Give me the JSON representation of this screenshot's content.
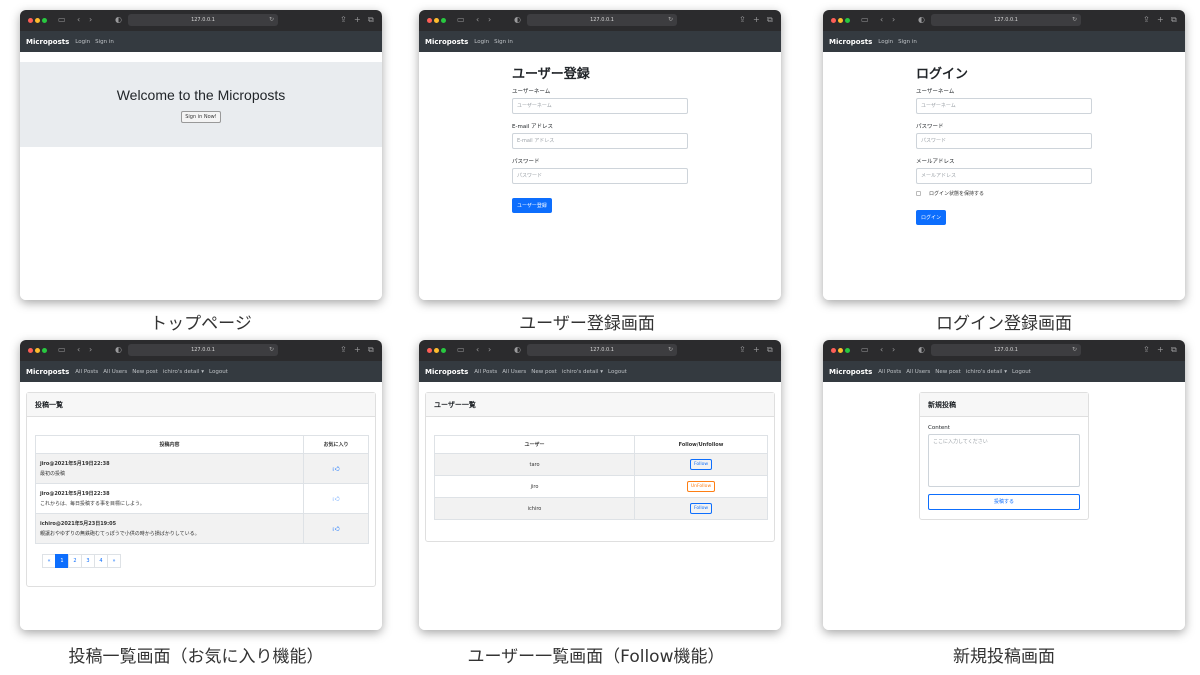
{
  "browser": {
    "address": "127.0.0.1"
  },
  "app": {
    "brand": "Microposts"
  },
  "nav_guest": {
    "login": "Login",
    "signin": "Sign in"
  },
  "nav_user": {
    "all_posts": "All Posts",
    "all_users": "All Users",
    "new_post": "New post",
    "detail": "ichiro's detail",
    "logout": "Logout"
  },
  "top": {
    "heading": "Welcome to the Microposts",
    "button": "Sign in Now!",
    "caption": "トップページ"
  },
  "register": {
    "heading": "ユーザー登録",
    "username_label": "ユーザーネーム",
    "username_placeholder": "ユーザーネーム",
    "email_label": "E-mail アドレス",
    "email_placeholder": "E-mail アドレス",
    "password_label": "パスワード",
    "password_placeholder": "パスワード",
    "submit": "ユーザー登録",
    "caption": "ユーザー登録画面"
  },
  "login": {
    "heading": "ログイン",
    "username_label": "ユーザーネーム",
    "username_placeholder": "ユーザーネーム",
    "password_label": "パスワード",
    "password_placeholder": "パスワード",
    "email_label": "メールアドレス",
    "email_placeholder": "メールアドレス",
    "remember": "ログイン状態を保持する",
    "submit": "ログイン",
    "caption": "ログイン登録画面"
  },
  "posts": {
    "title": "投稿一覧",
    "col_content": "投稿内容",
    "col_fav": "お気に入り",
    "rows": [
      {
        "meta": "jiro@2021年5月19日22:38",
        "text": "最初の投稿",
        "fav": "liked"
      },
      {
        "meta": "jiro@2021年5月19日22:38",
        "text": "これからは、毎日投稿する事を目標にしよう。",
        "fav": "not-liked"
      },
      {
        "meta": "ichiro@2021年5月23日19:05",
        "text": "親譲おやゆずりの無鉄砲むてっぽうで小供の時から損ばかりしている。",
        "fav": "liked"
      }
    ],
    "pages": [
      "«",
      "1",
      "2",
      "3",
      "4",
      "»"
    ],
    "current_page": "1",
    "caption": "投稿一覧画面（お気に入り機能）"
  },
  "users": {
    "title": "ユーザー一覧",
    "col_user": "ユーザー",
    "col_follow": "Follow/Unfollow",
    "rows": [
      {
        "name": "taro",
        "action": "Follow"
      },
      {
        "name": "jiro",
        "action": "UnFollow"
      },
      {
        "name": "ichiro",
        "action": "Follow"
      }
    ],
    "caption": "ユーザー一覧画面（Follow機能）"
  },
  "newpost": {
    "title": "新規投稿",
    "content_label": "Content",
    "placeholder": "ここに入力してください",
    "submit": "投稿する",
    "caption": "新規投稿画面"
  },
  "colors": {
    "primary": "#0d6efd",
    "navbar": "#343a40",
    "jumbotron": "#e9ecef",
    "unfollow": "#fd7e14"
  }
}
